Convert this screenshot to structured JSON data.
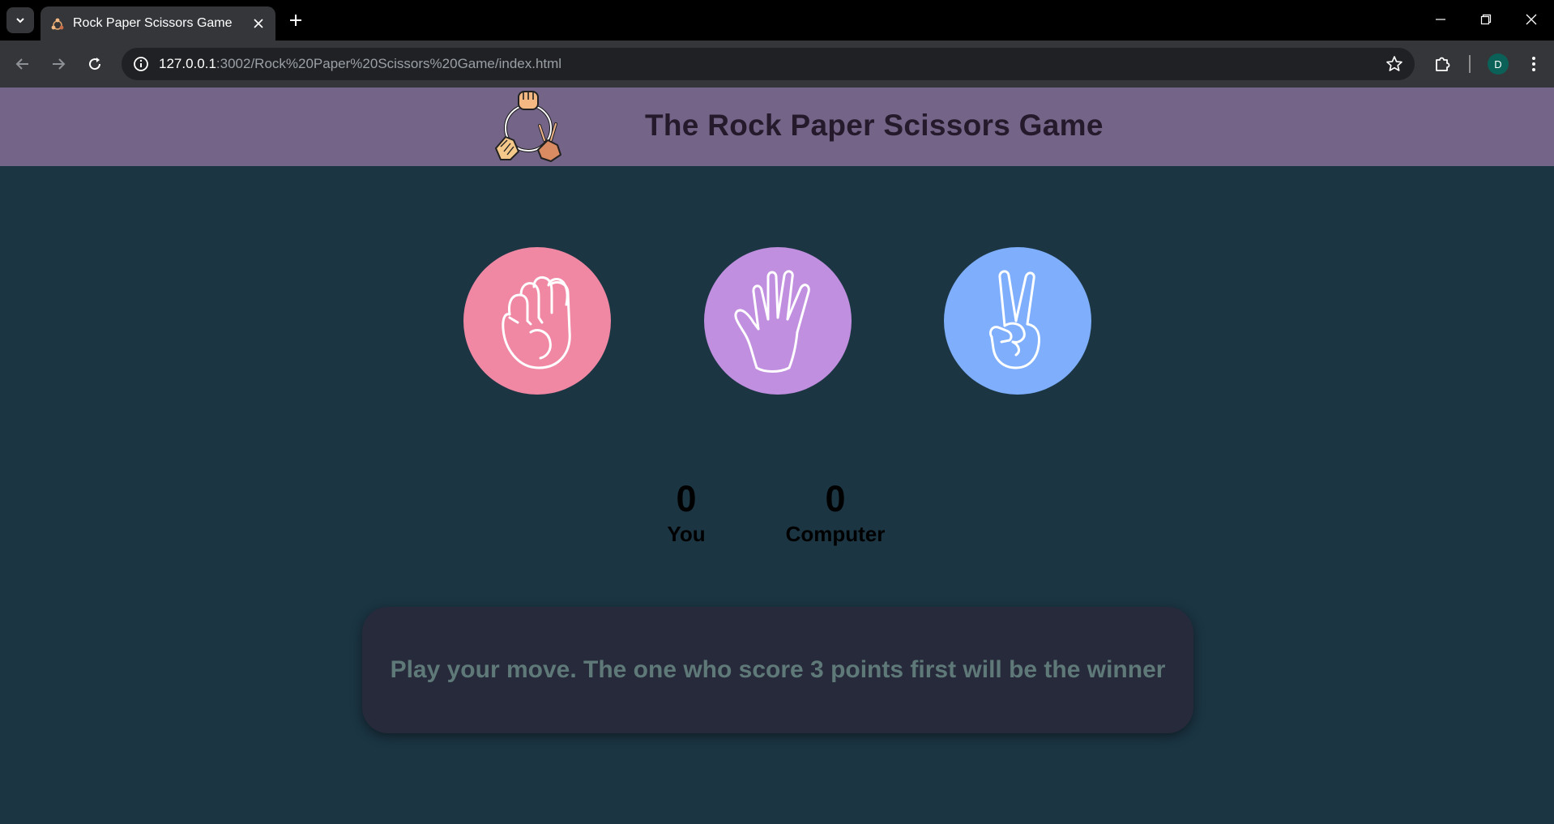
{
  "browser": {
    "tab_title": "Rock Paper Scissors Game",
    "url_host": "127.0.0.1",
    "url_rest": ":3002/Rock%20Paper%20Scissors%20Game/index.html",
    "profile_initial": "D"
  },
  "header": {
    "title": "The Rock Paper Scissors Game",
    "background": "#746487"
  },
  "choices": [
    {
      "name": "rock",
      "color": "#f087a3"
    },
    {
      "name": "paper",
      "color": "#c18fdf"
    },
    {
      "name": "scissors",
      "color": "#7eaefc"
    }
  ],
  "scoreboard": {
    "user_score": "0",
    "user_label": "You",
    "computer_score": "0",
    "computer_label": "Computer"
  },
  "message": {
    "text": "Play your move. The one who score 3 points first will be the winner"
  },
  "colors": {
    "page_background": "#1b3543",
    "message_box": "#262a3a",
    "message_text": "#5f7979"
  }
}
